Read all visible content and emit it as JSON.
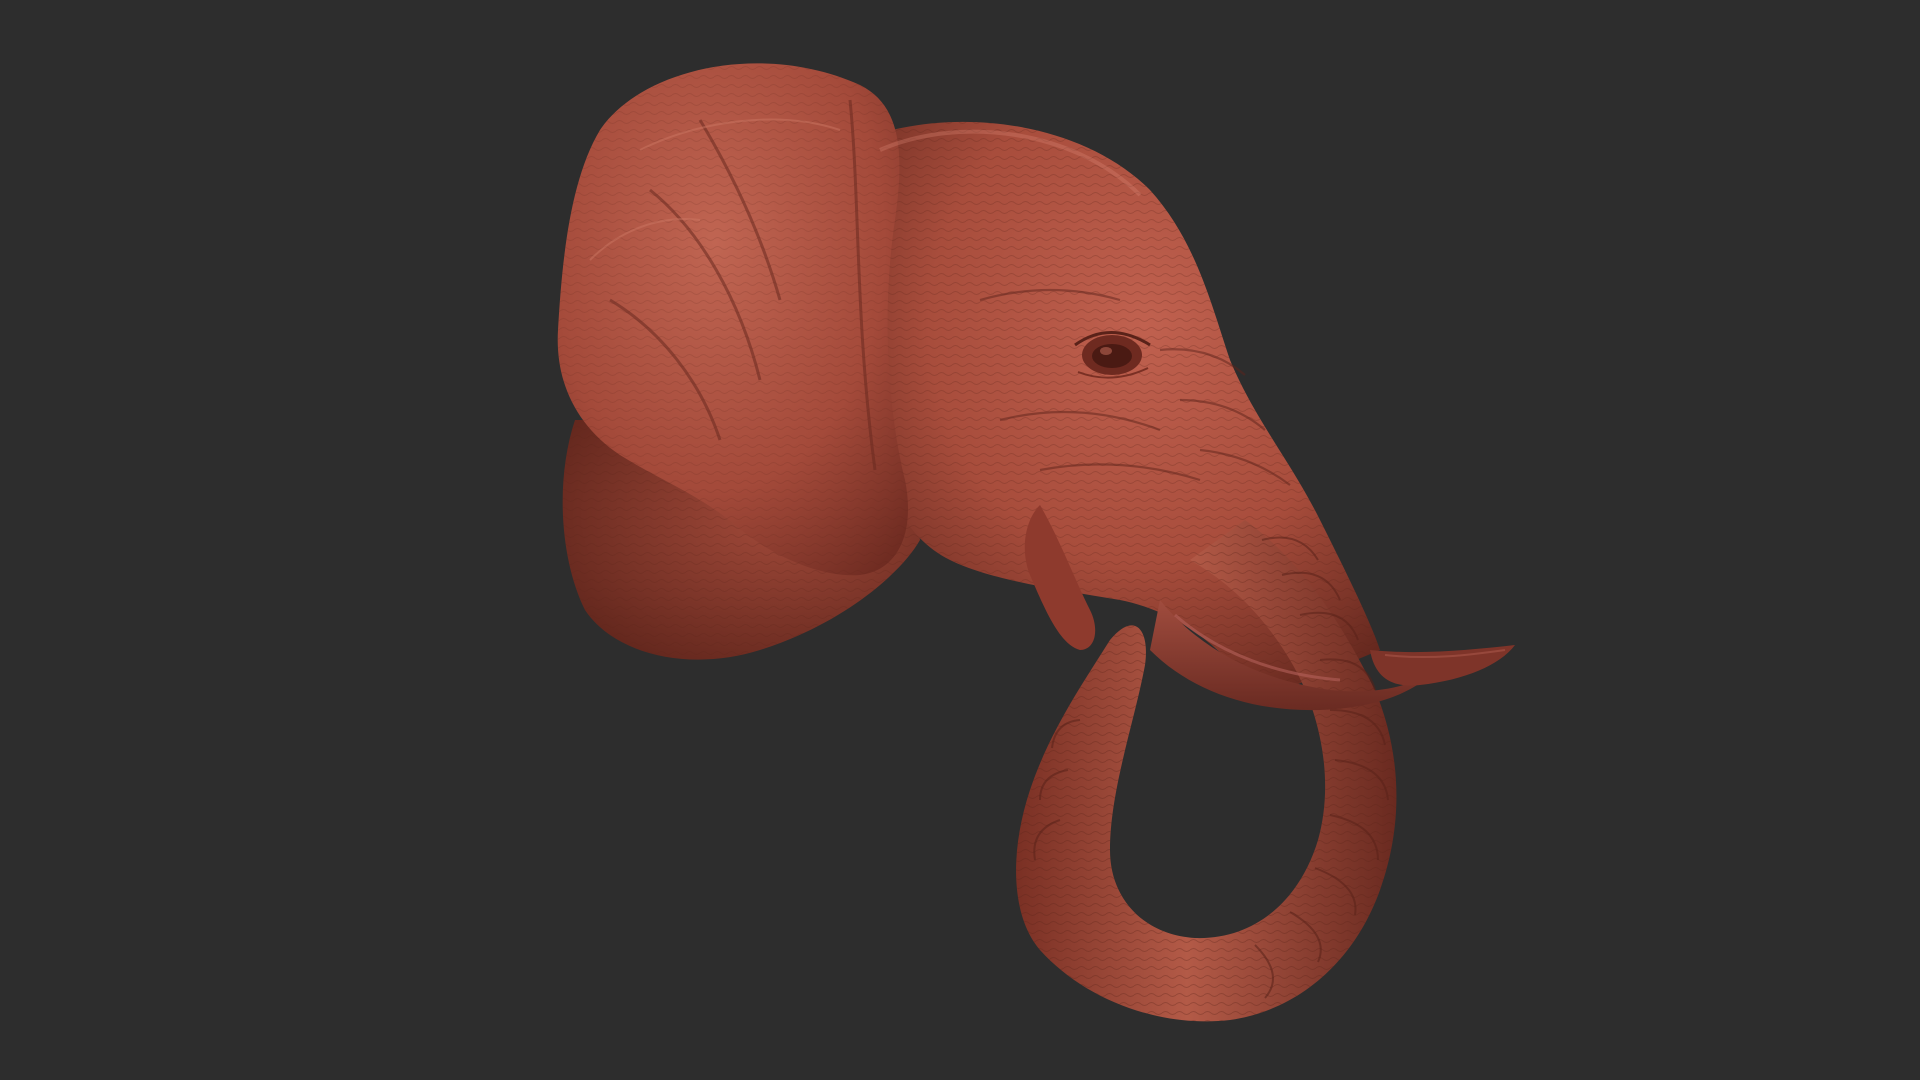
{
  "scene": {
    "background_color": "#2d2d2d",
    "model_color": "#a84d3c",
    "model_shadow_color": "#6b2a20",
    "model_highlight_color": "#c8705d",
    "tusk_color": "#8a3a2f",
    "tusk_highlight_color": "#b0584a",
    "subject": "elephant-head-sculpt"
  }
}
